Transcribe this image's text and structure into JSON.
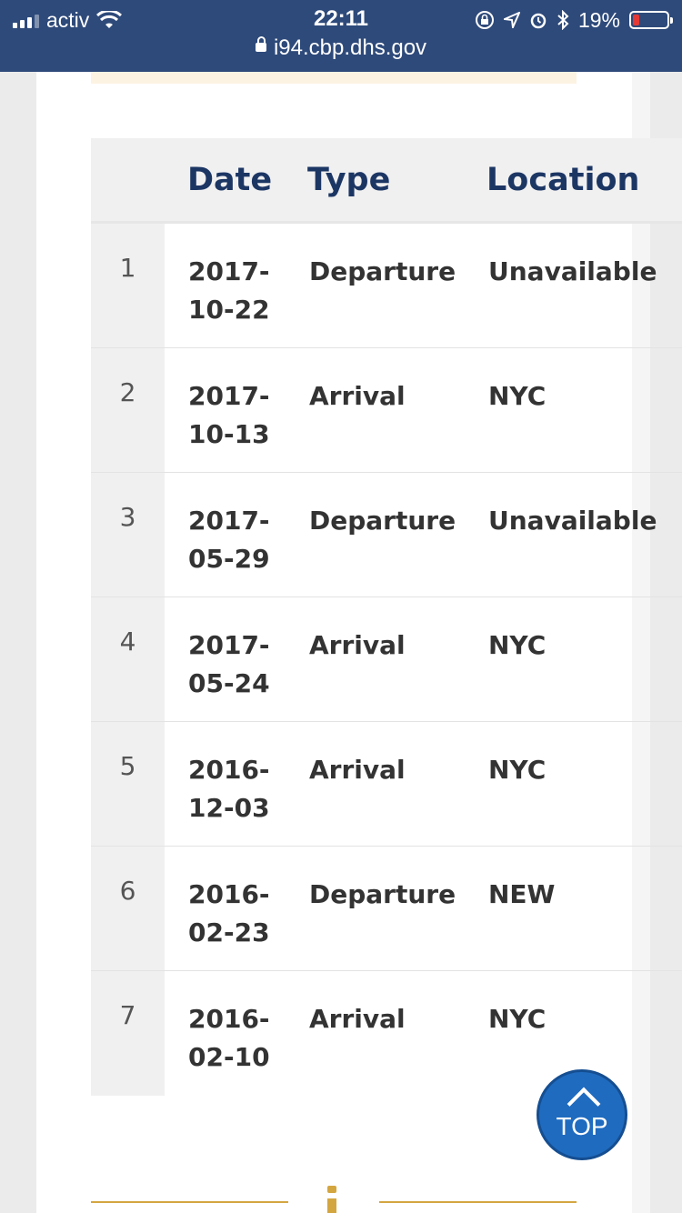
{
  "status_bar": {
    "carrier": "activ",
    "time": "22:11",
    "url": "i94.cbp.dhs.gov",
    "battery": "19%",
    "battery_level": 0.19
  },
  "table": {
    "headers": {
      "date": "Date",
      "type": "Type",
      "location": "Location"
    },
    "rows": [
      {
        "num": "1",
        "date_line1": "2017-",
        "date_line2": "10-22",
        "type": "Departure",
        "location": "Unavailable"
      },
      {
        "num": "2",
        "date_line1": "2017-",
        "date_line2": "10-13",
        "type": "Arrival",
        "location": "NYC"
      },
      {
        "num": "3",
        "date_line1": "2017-",
        "date_line2": "05-29",
        "type": "Departure",
        "location": "Unavailable"
      },
      {
        "num": "4",
        "date_line1": "2017-",
        "date_line2": "05-24",
        "type": "Arrival",
        "location": "NYC"
      },
      {
        "num": "5",
        "date_line1": "2016-",
        "date_line2": "12-03",
        "type": "Arrival",
        "location": "NYC"
      },
      {
        "num": "6",
        "date_line1": "2016-",
        "date_line2": "02-23",
        "type": "Departure",
        "location": "NEW"
      },
      {
        "num": "7",
        "date_line1": "2016-",
        "date_line2": "02-10",
        "type": "Arrival",
        "location": "NYC"
      }
    ]
  },
  "top_button": {
    "label": "TOP"
  },
  "colors": {
    "status_bar": "#2e4a7a",
    "header_text": "#1c3664",
    "top_button": "#1f6bbf",
    "accent_gold": "#d4a640"
  }
}
